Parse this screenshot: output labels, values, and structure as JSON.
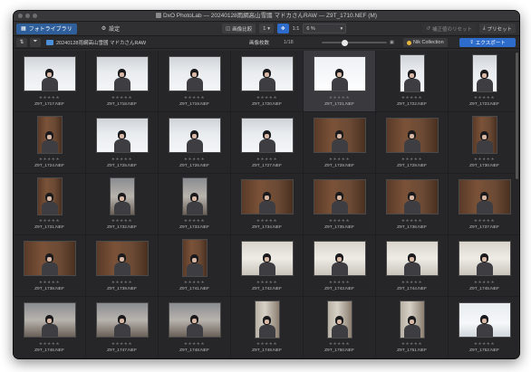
{
  "window": {
    "title": "DxO PhotoLab — 20240128雨網高山雪國 マドカさんRAW — Z9T_1710.NEF (M)"
  },
  "toolbar": {
    "tab_library": "フォトライブラリ",
    "tab_settings": "設定",
    "compare_label": "画像比較",
    "view_mode": "1",
    "ratio": "1:1",
    "zoom": "6 %",
    "reset_label": "補正値のリセット",
    "preset_label": "プリセット"
  },
  "pathbar": {
    "sort_icon": "sort-icon",
    "filter_icon": "filter-icon",
    "folder_name": "20240128雨網高山雪國 マドカさんRAW",
    "count_label": "画像枚数",
    "count_value": "1/18",
    "nik_label": "Nik Collection",
    "export_label": "エクスポート",
    "zoom_slider_level": 0.35
  },
  "colors": {
    "accent": "#2e6ccc",
    "window_bg": "#2b2b2d",
    "selected": "#3a3a3e"
  },
  "thumbnails": [
    {
      "name": "Z9T_1717.NEF",
      "stars": "★★★★★",
      "o": "land",
      "scene": "snow"
    },
    {
      "name": "Z9T_1718.NEF",
      "stars": "★★★★★",
      "o": "land",
      "scene": "snow"
    },
    {
      "name": "Z9T_1719.NEF",
      "stars": "★★★★★",
      "o": "land",
      "scene": "snow"
    },
    {
      "name": "Z9T_1720.NEF",
      "stars": "★★★★★",
      "o": "land",
      "scene": "snow"
    },
    {
      "name": "Z9T_1721.NEF",
      "stars": "★★★★★",
      "o": "land",
      "scene": "snowbright",
      "selected": true
    },
    {
      "name": "Z9T_1722.NEF",
      "stars": "★★★★★",
      "o": "port",
      "scene": "snow"
    },
    {
      "name": "Z9T_1723.NEF",
      "stars": "★★★★★",
      "o": "port",
      "scene": "snow"
    },
    {
      "name": "Z9T_1724.NEF",
      "stars": "★★★★★",
      "o": "port",
      "scene": "wood"
    },
    {
      "name": "Z9T_1725.NEF",
      "stars": "★★★★★",
      "o": "land",
      "scene": "snow"
    },
    {
      "name": "Z9T_1726.NEF",
      "stars": "★★★★★",
      "o": "land",
      "scene": "snow"
    },
    {
      "name": "Z9T_1727.NEF",
      "stars": "★★★★★",
      "o": "land",
      "scene": "snow"
    },
    {
      "name": "Z9T_1728.NEF",
      "stars": "★★★★★",
      "o": "land",
      "scene": "wood"
    },
    {
      "name": "Z9T_1729.NEF",
      "stars": "★★★★★",
      "o": "land",
      "scene": "wood"
    },
    {
      "name": "Z9T_1730.NEF",
      "stars": "★★★★★",
      "o": "port",
      "scene": "wood"
    },
    {
      "name": "Z9T_1731.NEF",
      "stars": "★★★★★",
      "o": "port",
      "scene": "wood"
    },
    {
      "name": "Z9T_1732.NEF",
      "stars": "★★★★★",
      "o": "port",
      "scene": "street"
    },
    {
      "name": "Z9T_1733.NEF",
      "stars": "★★★★★",
      "o": "port",
      "scene": "street"
    },
    {
      "name": "Z9T_1734.NEF",
      "stars": "★★★★★",
      "o": "land",
      "scene": "wood"
    },
    {
      "name": "Z9T_1735.NEF",
      "stars": "★★★★★",
      "o": "land",
      "scene": "wood"
    },
    {
      "name": "Z9T_1736.NEF",
      "stars": "★★★★★",
      "o": "land",
      "scene": "wood"
    },
    {
      "name": "Z9T_1737.NEF",
      "stars": "★★★★★",
      "o": "land",
      "scene": "wood"
    },
    {
      "name": "Z9T_1738.NEF",
      "stars": "★★★★★",
      "o": "land",
      "scene": "wood"
    },
    {
      "name": "Z9T_1739.NEF",
      "stars": "★★★★★",
      "o": "land",
      "scene": "wood"
    },
    {
      "name": "Z9T_1741.NEF",
      "stars": "★★★★★",
      "o": "port",
      "scene": "wood"
    },
    {
      "name": "Z9T_1742.NEF",
      "stars": "★★★★★",
      "o": "land",
      "scene": "light"
    },
    {
      "name": "Z9T_1743.NEF",
      "stars": "★★★★★",
      "o": "land",
      "scene": "light"
    },
    {
      "name": "Z9T_1744.NEF",
      "stars": "★★★★★",
      "o": "land",
      "scene": "light"
    },
    {
      "name": "Z9T_1745.NEF",
      "stars": "★★★★★",
      "o": "land",
      "scene": "light"
    },
    {
      "name": "Z9T_1746.NEF",
      "stars": "★★★★★",
      "o": "land",
      "scene": "street"
    },
    {
      "name": "Z9T_1747.NEF",
      "stars": "★★★★★",
      "o": "land",
      "scene": "street"
    },
    {
      "name": "Z9T_1748.NEF",
      "stars": "★★★★★",
      "o": "land",
      "scene": "street"
    },
    {
      "name": "Z9T_1749.NEF",
      "stars": "★★★★★",
      "o": "port",
      "scene": "shrine"
    },
    {
      "name": "Z9T_1750.NEF",
      "stars": "★★★★★",
      "o": "port",
      "scene": "shrine"
    },
    {
      "name": "Z9T_1751.NEF",
      "stars": "★★★★★",
      "o": "port",
      "scene": "shrine"
    },
    {
      "name": "Z9T_1752.NEF",
      "stars": "★★★★★",
      "o": "land",
      "scene": "snowtree"
    }
  ]
}
